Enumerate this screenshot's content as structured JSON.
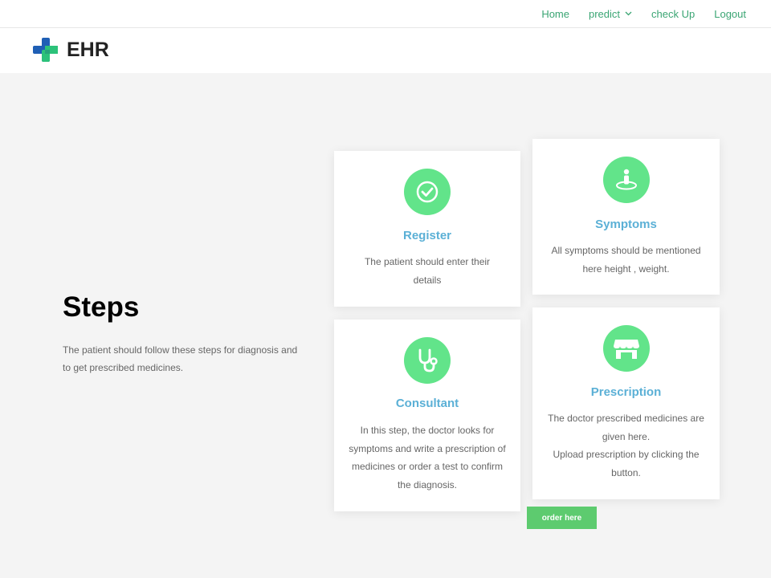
{
  "nav": {
    "items": [
      {
        "label": "Home"
      },
      {
        "label": "predict",
        "has_dropdown": true
      },
      {
        "label": "check Up"
      },
      {
        "label": "Logout"
      }
    ]
  },
  "brand": {
    "name": "EHR",
    "icon": "medical-cross-icon"
  },
  "steps": {
    "title": "Steps",
    "description": "The patient should  follow these steps for diagnosis and to get prescribed medicines."
  },
  "cards": {
    "register": {
      "icon": "check-circle-icon",
      "title": "Register",
      "text": "The patient should enter their details"
    },
    "symptoms": {
      "icon": "person-location-icon",
      "title": "Symptoms",
      "text": "All symptoms should be mentioned here height , weight."
    },
    "consultant": {
      "icon": "stethoscope-icon",
      "title": "Consultant",
      "text": "In this step, the doctor looks for symptoms and write a prescription of medicines or order a test to confirm the diagnosis."
    },
    "prescription": {
      "icon": "store-icon",
      "title": "Prescription",
      "text_line1": "The doctor prescribed medicines are given here.",
      "text_line2": "Upload prescription by clicking the button."
    }
  },
  "order_button": {
    "label": "order here"
  },
  "colors": {
    "nav_link": "#3aa573",
    "icon_circle": "#62e48a",
    "card_title": "#5bb0d6",
    "button": "#5dcb6f",
    "background": "#f4f4f4"
  }
}
